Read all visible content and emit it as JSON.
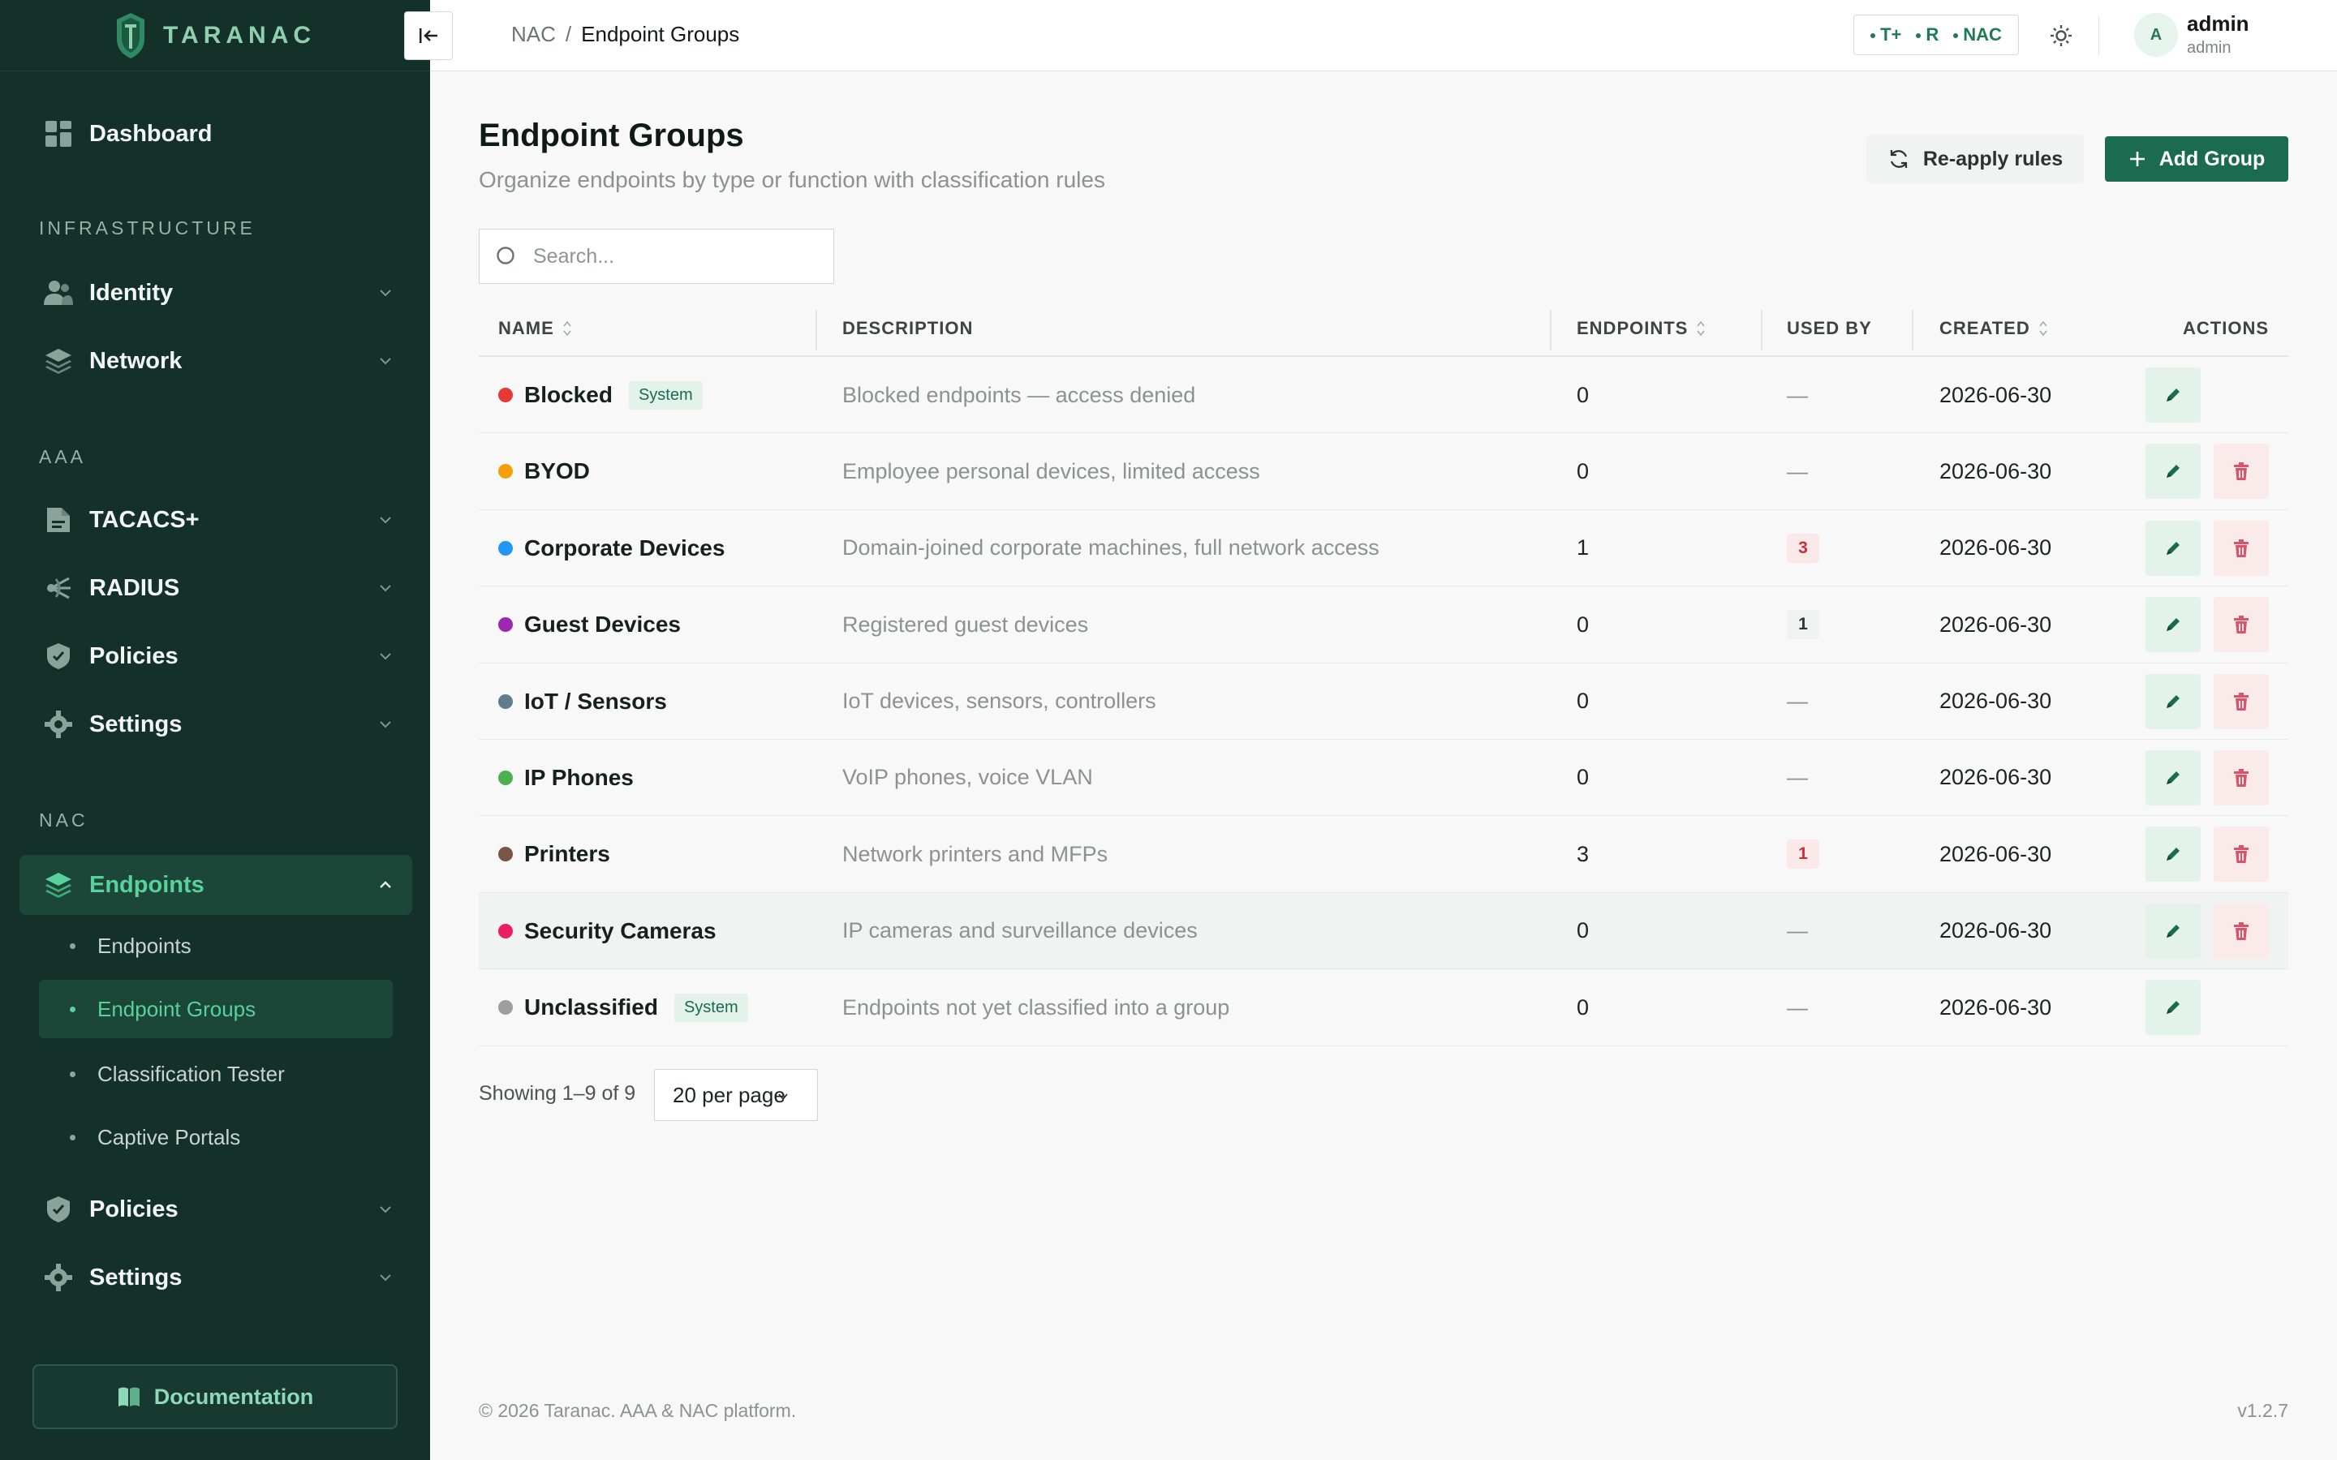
{
  "brand": {
    "name": "TARANAC"
  },
  "sidebar": {
    "dashboard": "Dashboard",
    "infra_label": "INFRASTRUCTURE",
    "identity": "Identity",
    "network": "Network",
    "aaa_label": "AAA",
    "tacacs": "TACACS+",
    "radius": "RADIUS",
    "policies_aaa": "Policies",
    "settings_aaa": "Settings",
    "nac_label": "NAC",
    "endpoints": "Endpoints",
    "sub": [
      "Endpoints",
      "Endpoint Groups",
      "Classification Tester",
      "Captive Portals"
    ],
    "policies_nac": "Policies",
    "settings_nac": "Settings",
    "documentation": "Documentation"
  },
  "topbar": {
    "breadcrumb_root": "NAC",
    "breadcrumb_sep": "/",
    "breadcrumb_current": "Endpoint Groups",
    "status": [
      "T+",
      "R",
      "NAC"
    ],
    "user_initial": "A",
    "user_name": "admin",
    "user_role": "admin"
  },
  "page": {
    "title": "Endpoint Groups",
    "subtitle": "Organize endpoints by type or function with classification rules",
    "reapply_label": "Re-apply rules",
    "add_label": "Add Group",
    "search_placeholder": "Search..."
  },
  "table": {
    "headers": {
      "name": "NAME",
      "description": "DESCRIPTION",
      "endpoints": "ENDPOINTS",
      "used_by": "USED BY",
      "created": "CREATED",
      "actions": "ACTIONS"
    },
    "rows": [
      {
        "name": "Blocked",
        "color": "#e53935",
        "system": "System",
        "description": "Blocked endpoints — access denied",
        "endpoints": "0",
        "used_by": "—",
        "created": "2026-06-30",
        "deletable": false
      },
      {
        "name": "BYOD",
        "color": "#f59e0b",
        "system": "",
        "description": "Employee personal devices, limited access",
        "endpoints": "0",
        "used_by": "—",
        "created": "2026-06-30",
        "deletable": true
      },
      {
        "name": "Corporate Devices",
        "color": "#2196f3",
        "system": "",
        "description": "Domain-joined corporate machines, full network access",
        "endpoints": "1",
        "used_by": "3",
        "used_style": "red",
        "created": "2026-06-30",
        "deletable": true
      },
      {
        "name": "Guest Devices",
        "color": "#9c27b0",
        "system": "",
        "description": "Registered guest devices",
        "endpoints": "0",
        "used_by": "1",
        "used_style": "gray",
        "created": "2026-06-30",
        "deletable": true
      },
      {
        "name": "IoT / Sensors",
        "color": "#607d8b",
        "system": "",
        "description": "IoT devices, sensors, controllers",
        "endpoints": "0",
        "used_by": "—",
        "created": "2026-06-30",
        "deletable": true
      },
      {
        "name": "IP Phones",
        "color": "#4caf50",
        "system": "",
        "description": "VoIP phones, voice VLAN",
        "endpoints": "0",
        "used_by": "—",
        "created": "2026-06-30",
        "deletable": true
      },
      {
        "name": "Printers",
        "color": "#795548",
        "system": "",
        "description": "Network printers and MFPs",
        "endpoints": "3",
        "used_by": "1",
        "used_style": "red",
        "created": "2026-06-30",
        "deletable": true
      },
      {
        "name": "Security Cameras",
        "color": "#e91e63",
        "system": "",
        "description": "IP cameras and surveillance devices",
        "endpoints": "0",
        "used_by": "—",
        "created": "2026-06-30",
        "deletable": true
      },
      {
        "name": "Unclassified",
        "color": "#9e9e9e",
        "system": "System",
        "description": "Endpoints not yet classified into a group",
        "endpoints": "0",
        "used_by": "—",
        "created": "2026-06-30",
        "deletable": false
      }
    ]
  },
  "pagination": {
    "showing": "Showing 1–9 of 9",
    "per_page": "20 per page"
  },
  "footer": {
    "copyright": "© 2026 Taranac. AAA & NAC platform.",
    "version": "v1.2.7"
  },
  "colors": {
    "sidebar_bg": "#143129",
    "accent": "#1a6b4f",
    "active_text": "#58d19b",
    "danger": "#c6303b"
  }
}
